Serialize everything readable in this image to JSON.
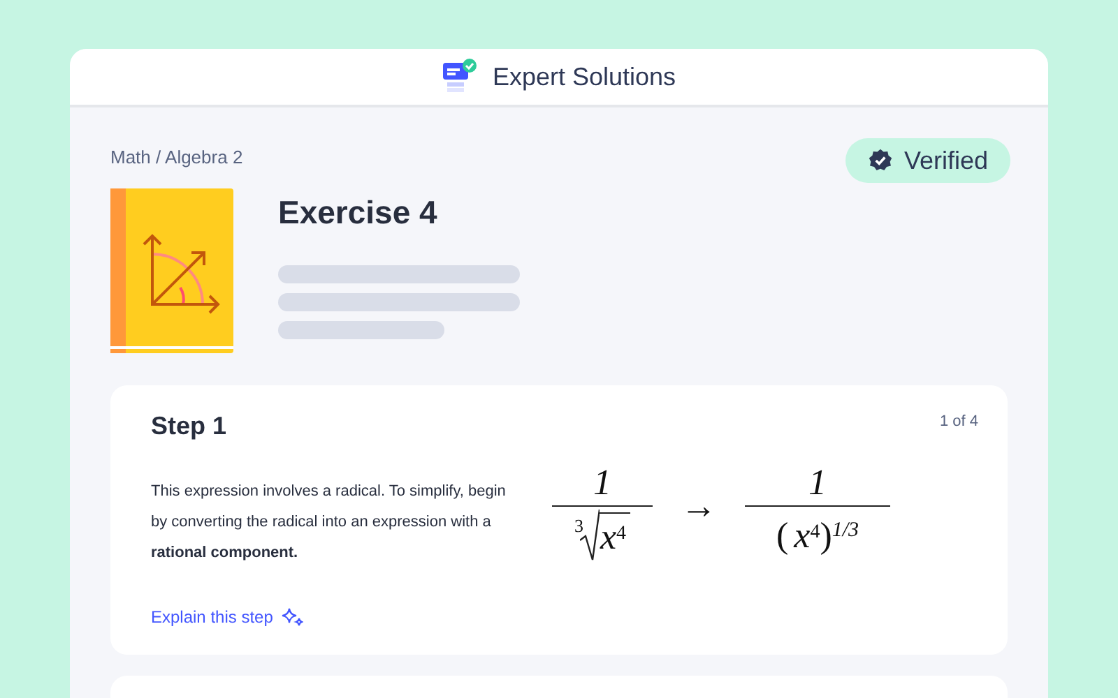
{
  "header": {
    "title": "Expert Solutions"
  },
  "breadcrumb": "Math / Algebra 2",
  "badge": {
    "label": "Verified"
  },
  "exercise": {
    "title": "Exercise 4"
  },
  "step": {
    "title": "Step 1",
    "counter": "1 of 4",
    "text": "This expression involves a radical. To simplify, begin by converting the radical into an expression with a **rational component.**",
    "link": "Explain this step",
    "math": {
      "left": {
        "numerator": "1",
        "root_index": "3",
        "base": "x",
        "exponent": "4"
      },
      "arrow": "→",
      "right": {
        "numerator": "1",
        "open": "(",
        "base": "x",
        "exponent": "4",
        "close": ")",
        "power": "1/3"
      }
    }
  }
}
